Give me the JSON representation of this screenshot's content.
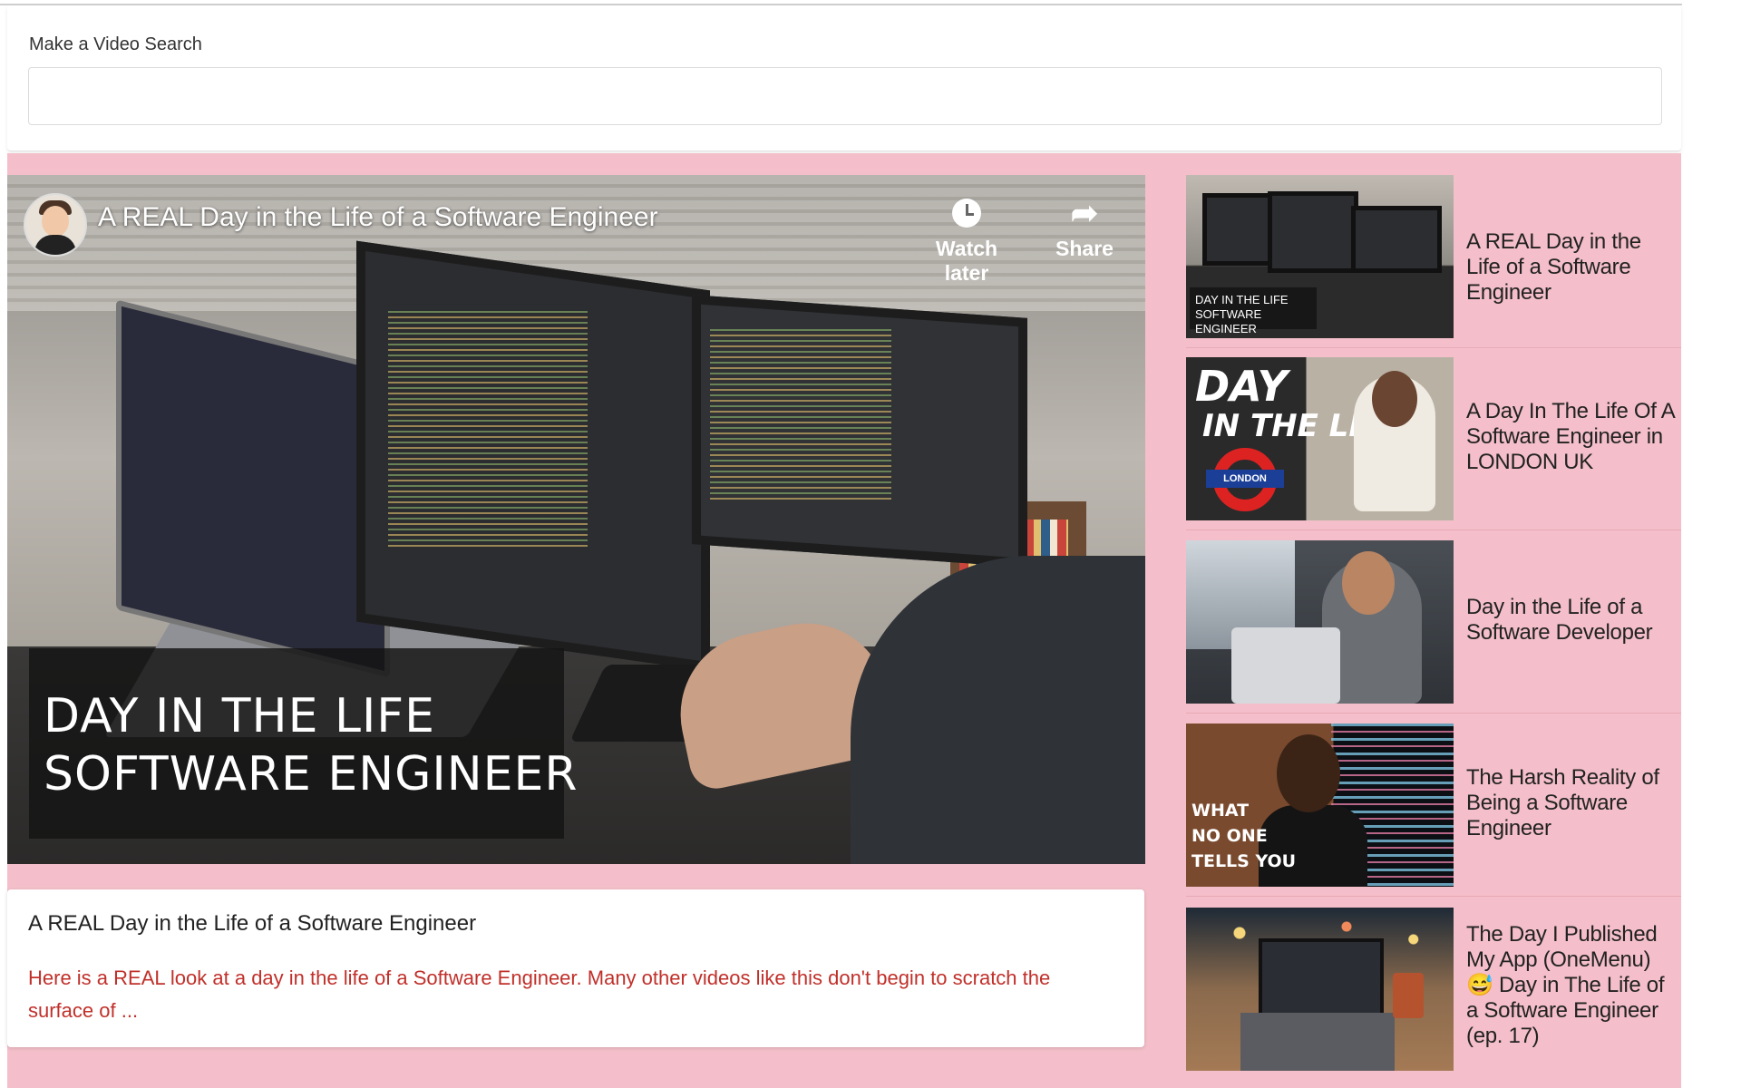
{
  "search": {
    "label": "Make a Video Search",
    "value": "",
    "placeholder": ""
  },
  "player": {
    "title": "A REAL Day in the Life of a Software Engineer",
    "watch_later_label": "Watch later",
    "share_label": "Share",
    "caption_line1": "DAY IN THE LIFE",
    "caption_line2": "SOFTWARE ENGINEER"
  },
  "selected": {
    "title": "A REAL Day in the Life of a Software Engineer",
    "description": "Here is a REAL look at a day in the life of a Software Engineer. Many other videos like this don't begin to scratch the surface of ..."
  },
  "list": [
    {
      "title": "A REAL Day in the Life of a Software Engineer",
      "thumb_text": "DAY IN THE LIFE\nSOFTWARE ENGINEER"
    },
    {
      "title": "A Day In The Life Of A Software Engineer in LONDON UK",
      "thumb_text": "DAY",
      "thumb_text2": "IN THE LIFE",
      "thumb_badge": "LONDON"
    },
    {
      "title": "Day in the Life of a Software Developer"
    },
    {
      "title": "The Harsh Reality of Being a Software Engineer",
      "thumb_text": "WHAT\nNO ONE\nTELLS YOU"
    },
    {
      "title": "The Day I Published My App (OneMenu) 😅 Day in The Life of a Software Engineer (ep. 17)"
    }
  ],
  "colors": {
    "background_pink": "#f4bfca",
    "description_red": "#c0302a"
  }
}
